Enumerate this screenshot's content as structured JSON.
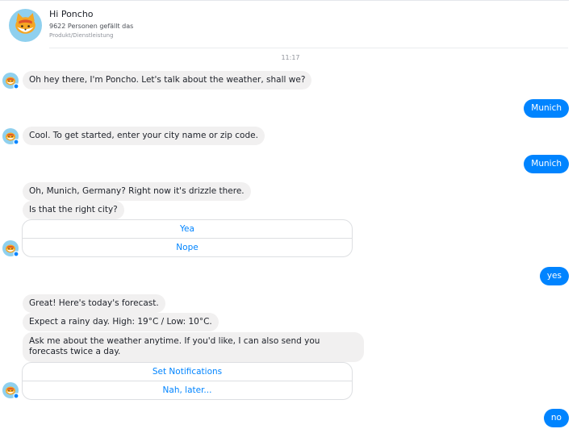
{
  "header": {
    "title": "Hi Poncho",
    "likes": "9622 Personen gefällt das",
    "category": "Produkt/Dienstleistung"
  },
  "conversation": {
    "timestamp": "11:17",
    "bot_messages": {
      "greeting": "Oh hey there, I'm Poncho. Let's talk about the weather, shall we?",
      "enter_city": "Cool. To get started, enter your city name or zip code.",
      "city_found": "Oh, Munich, Germany? Right now it's drizzle there.",
      "confirm_city": "Is that the right city?",
      "forecast_intro": "Great! Here's today's forecast.",
      "forecast": "Expect a rainy day. High: 19°C / Low: 10°C.",
      "notifications_offer": "Ask me about the weather anytime. If you'd like, I can also send you forecasts twice a day."
    },
    "user_messages": {
      "first": "Munich",
      "second": "Munich",
      "third": "yes",
      "fourth": "no"
    },
    "quick_replies": {
      "confirm": [
        "Yea",
        "Nope"
      ],
      "notifications": [
        "Set Notifications",
        "Nah, later..."
      ]
    }
  },
  "colors": {
    "accent": "#0084ff",
    "bubble_in": "#f1f0f0",
    "mascot": "#f5a623"
  }
}
